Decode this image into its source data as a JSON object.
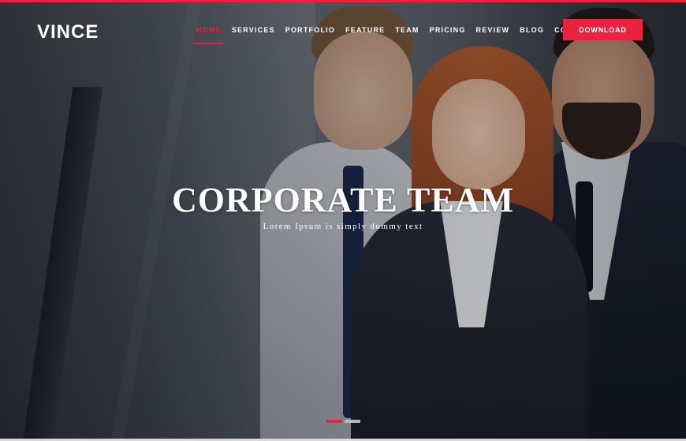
{
  "header": {
    "logo_text": "VINCE",
    "nav": [
      {
        "label": "HOME",
        "active": true
      },
      {
        "label": "SERVICES"
      },
      {
        "label": "PORTFOLIO"
      },
      {
        "label": "FEATURE"
      },
      {
        "label": "TEAM"
      },
      {
        "label": "PRICING"
      },
      {
        "label": "REVIEW"
      },
      {
        "label": "BLOG"
      },
      {
        "label": "CONTACT"
      }
    ],
    "download_label": "DOWNLOAD"
  },
  "hero": {
    "title": "CORPORATE TEAM",
    "subtitle": "Lorem Ipsum is simply dummy text",
    "slider_dots": [
      {
        "active": true
      },
      {
        "active": false
      }
    ]
  },
  "colors": {
    "accent": "#e8223f",
    "inactive_dot": "#b7b9bd",
    "text": "#ffffff"
  }
}
